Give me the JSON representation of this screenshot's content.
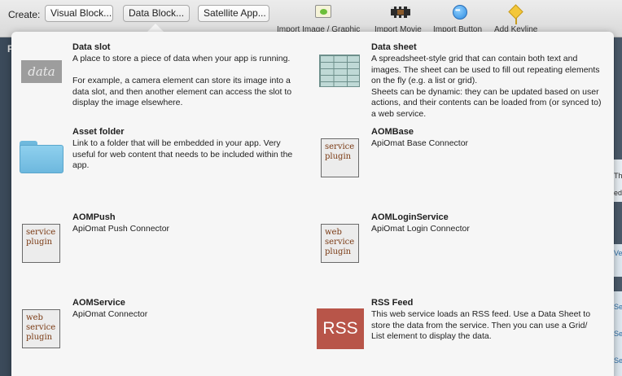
{
  "toolbar": {
    "create_label": "Create:",
    "buttons": [
      "Visual Block...",
      "Data Block...",
      "Satellite App..."
    ],
    "tools": [
      {
        "label": "Import Image / Graphic",
        "icon": "image-icon"
      },
      {
        "label": "Import Movie",
        "icon": "movie-icon"
      },
      {
        "label": "Import Button",
        "icon": "button-icon"
      },
      {
        "label": "Add Keyline",
        "icon": "keyline-icon"
      }
    ]
  },
  "background": {
    "left_letter": "P",
    "right_fragments": [
      "Thi",
      "edi",
      "Ve",
      "Ser",
      "Ser",
      "Ser"
    ]
  },
  "items": [
    {
      "title": "Data slot",
      "icon_text": "data",
      "description": "A place to store a piece of data when your app is running.\n\nFor example, a camera element can store its image into a data slot, and then another element can access the slot to display the image elsewhere."
    },
    {
      "title": "Data sheet",
      "description": "A spreadsheet-style grid that can contain both text and images. The sheet can be used to fill out repeating elements on the fly (e.g. a list or grid).\nSheets can be dynamic: they can be updated based on user actions, and their contents can be loaded from (or synced to) a web service."
    },
    {
      "title": "Asset folder",
      "description": "Link to a folder that will be embedded in your app. Very useful for web content that needs to be included within the app."
    },
    {
      "title": "AOMBase",
      "icon_text": "service\nplugin",
      "description": "ApiOmat Base Connector"
    },
    {
      "title": "AOMPush",
      "icon_text": "service\nplugin",
      "description": "ApiOmat Push Connector"
    },
    {
      "title": "AOMLoginService",
      "icon_text": "web\nservice\nplugin",
      "description": "ApiOmat Login Connector"
    },
    {
      "title": "AOMService",
      "icon_text": "web\nservice\nplugin",
      "description": "ApiOmat Connector"
    },
    {
      "title": "RSS Feed",
      "icon_text": "RSS",
      "description": "This web service loads an RSS feed. Use a Data Sheet to store the data from the service. Then you can use a Grid/\nList element to display the data."
    }
  ]
}
